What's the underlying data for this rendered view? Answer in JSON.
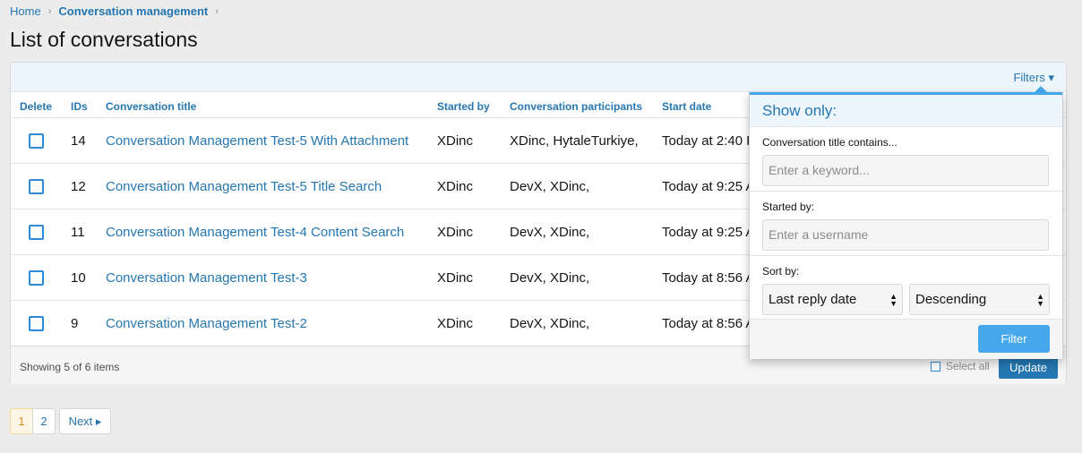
{
  "breadcrumb": {
    "home": "Home",
    "current": "Conversation management",
    "sep": "›"
  },
  "page_title": "List of conversations",
  "filter_bar": {
    "toggle_label": "Filters ▾"
  },
  "table": {
    "headers": [
      "Delete",
      "IDs",
      "Conversation title",
      "Started by",
      "Conversation participants",
      "Start date"
    ],
    "rows": [
      {
        "id": "14",
        "title": "Conversation Management Test-5 With Attachment",
        "started_by": "XDinc",
        "participants": "XDinc, HytaleTurkiye,",
        "start_date": "Today at 2:40 P"
      },
      {
        "id": "12",
        "title": "Conversation Management Test-5 Title Search",
        "started_by": "XDinc",
        "participants": "DevX, XDinc,",
        "start_date": "Today at 9:25 A"
      },
      {
        "id": "11",
        "title": "Conversation Management Test-4 Content Search",
        "started_by": "XDinc",
        "participants": "DevX, XDinc,",
        "start_date": "Today at 9:25 A"
      },
      {
        "id": "10",
        "title": "Conversation Management Test-3",
        "started_by": "XDinc",
        "participants": "DevX, XDinc,",
        "start_date": "Today at 8:56 A"
      },
      {
        "id": "9",
        "title": "Conversation Management Test-2",
        "started_by": "XDinc",
        "participants": "DevX, XDinc,",
        "start_date": "Today at 8:56 A"
      }
    ]
  },
  "footer": {
    "count": "Showing 5 of 6 items",
    "select_all": "Select all",
    "update": "Update"
  },
  "pager": {
    "page1": "1",
    "page2": "2",
    "next": "Next ▸"
  },
  "filter_menu": {
    "header": "Show only:",
    "title_label": "Conversation title contains...",
    "title_placeholder": "Enter a keyword...",
    "started_label": "Started by:",
    "started_placeholder": "Enter a username",
    "sort_label": "Sort by:",
    "sort_field": "Last reply date",
    "sort_dir": "Descending",
    "filter_button": "Filter"
  },
  "colors": {
    "accent": "#2577b1",
    "menu_border": "#47a7eb"
  }
}
